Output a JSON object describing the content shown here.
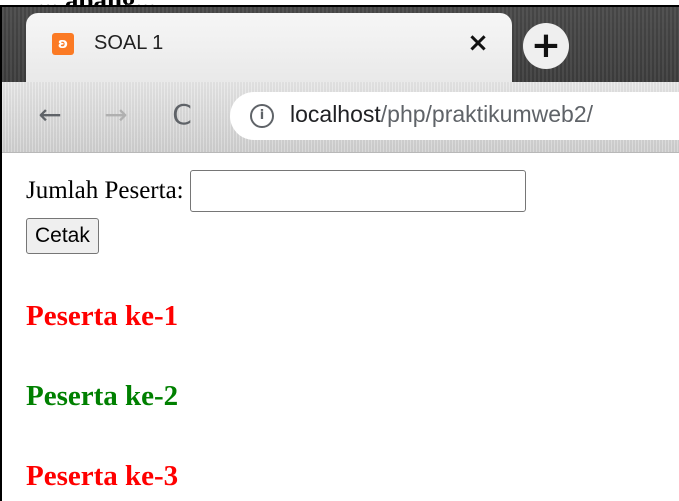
{
  "document": {
    "heading_fragment": "... apang..."
  },
  "browser": {
    "tab": {
      "title": "SOAL 1",
      "favicon": "xampp-favicon-icon",
      "close_glyph": "×"
    },
    "new_tab_glyph": "+",
    "nav": {
      "back_glyph": "←",
      "forward_glyph": "→",
      "reload_glyph": "C"
    },
    "address": {
      "info_glyph": "i",
      "host": "localhost",
      "path": "/php/praktikumweb2/"
    }
  },
  "form": {
    "label": "Jumlah Peserta:",
    "input_value": "",
    "button_label": "Cetak"
  },
  "output": {
    "items": [
      {
        "text": "Peserta ke-1",
        "color": "#ff0000"
      },
      {
        "text": "Peserta ke-2",
        "color": "#008000"
      },
      {
        "text": "Peserta ke-3",
        "color": "#ff0000"
      }
    ]
  }
}
